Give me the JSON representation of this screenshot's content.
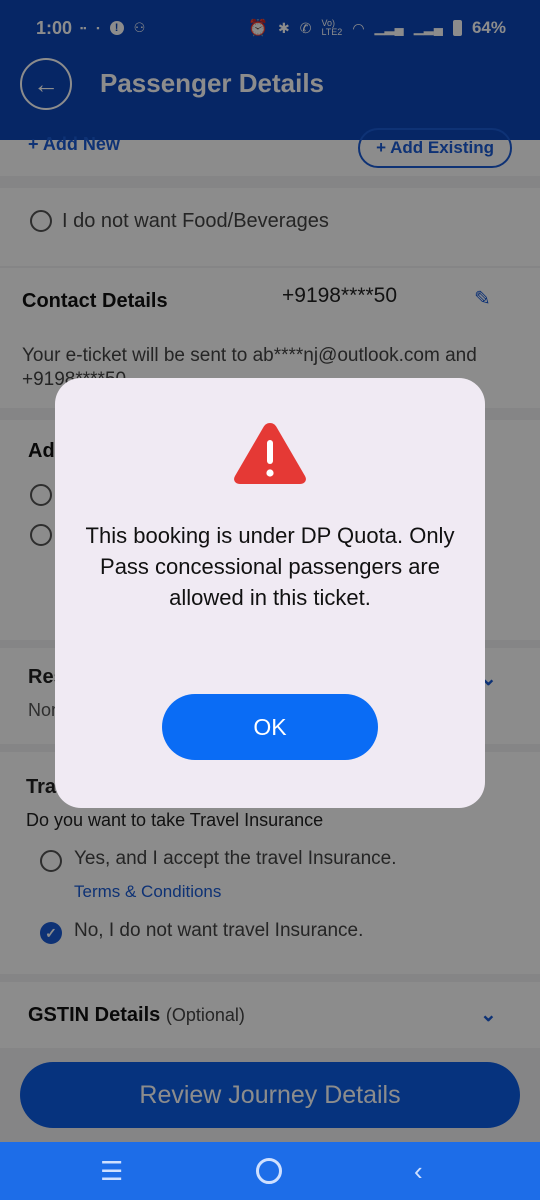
{
  "status_bar": {
    "time": "1:00",
    "battery_percent": "64%",
    "left_icons": [
      "paytm-icon",
      "app-icon",
      "alert-icon",
      "incognito-icon"
    ],
    "right_icons": [
      "alarm-icon",
      "bluetooth-icon",
      "call-icon",
      "volte-icon",
      "wifi-icon",
      "signal-icon",
      "signal-icon",
      "battery-icon"
    ]
  },
  "header": {
    "title": "Passenger Details"
  },
  "passengers": {
    "add_new_label": "+ Add New",
    "add_existing_label": "+ Add Existing"
  },
  "food": {
    "option_label": "I do not want Food/Beverages"
  },
  "contact": {
    "title": "Contact Details",
    "phone": "+9198****50",
    "note": "Your e-ticket will be sent to ab****nj@outlook.com and +9198****50"
  },
  "address": {
    "title_partial": "Ad"
  },
  "reservation": {
    "title_partial": "Res",
    "subtitle_partial": "Non"
  },
  "insurance": {
    "title_partial": "Tra",
    "question": "Do you want to take Travel Insurance",
    "option_yes": "Yes, and I accept the travel Insurance.",
    "terms_link": "Terms & Conditions",
    "option_no": "No, I do not want travel Insurance.",
    "selected": "no"
  },
  "gstin": {
    "title": "GSTIN Details",
    "optional": "(Optional)"
  },
  "review_button": "Review Journey Details",
  "dialog": {
    "message": "This booking is under DP Quota. Only Pass concessional passengers are allowed in this ticket.",
    "ok_label": "OK"
  },
  "colors": {
    "primary": "#0b45b8",
    "accent": "#0a6cf5",
    "warning": "#e53935",
    "dialog_bg": "#f0eaf3"
  }
}
